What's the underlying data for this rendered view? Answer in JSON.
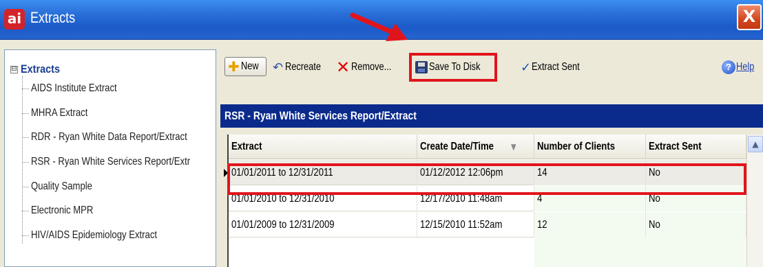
{
  "window": {
    "app_logo": "ai",
    "title": "Extracts",
    "close_glyph": "X"
  },
  "tree": {
    "expander": "⊟",
    "root_label": "Extracts",
    "items": [
      {
        "label": "AIDS Institute Extract"
      },
      {
        "label": "MHRA Extract"
      },
      {
        "label": "RDR - Ryan White Data Report/Extract"
      },
      {
        "label": "RSR - Ryan White Services Report/Extr"
      },
      {
        "label": "Quality Sample"
      },
      {
        "label": "Electronic MPR"
      },
      {
        "label": "HIV/AIDS Epidemiology Extract"
      }
    ],
    "selected_index": 3
  },
  "toolbar": {
    "new_label": "New",
    "recreate_label": "Recreate",
    "remove_label": "Remove...",
    "save_label": "Save To Disk",
    "extract_sent_label": "Extract Sent",
    "help_label": "Help",
    "icons": {
      "new": "plus-icon",
      "recreate": "undo-arrow-icon",
      "remove": "x-icon",
      "save": "floppy-disk-icon",
      "extract_sent": "checkmark-icon",
      "help": "help-circle-icon"
    }
  },
  "section": {
    "title": "RSR - Ryan White Services Report/Extract"
  },
  "grid": {
    "columns": [
      "Extract",
      "Create Date/Time",
      "Number of Clients",
      "Extract Sent"
    ],
    "sort_indicator": "▼",
    "rows": [
      {
        "extract": "01/01/2011 to 12/31/2011",
        "created": "01/12/2012 12:06pm",
        "clients": "14",
        "sent": "No"
      },
      {
        "extract": "01/01/2010 to 12/31/2010",
        "created": "12/17/2010 11:48am",
        "clients": "4",
        "sent": "No"
      },
      {
        "extract": "01/01/2009 to 12/31/2009",
        "created": "12/15/2010 11:52am",
        "clients": "12",
        "sent": "No"
      }
    ],
    "selected_row": 0
  },
  "annotations": {
    "highlight_color": "#e1141c"
  },
  "colors": {
    "titlebar": "#2a6fd8",
    "section_header": "#0a2a8c",
    "root_label": "#1b3f8f"
  }
}
